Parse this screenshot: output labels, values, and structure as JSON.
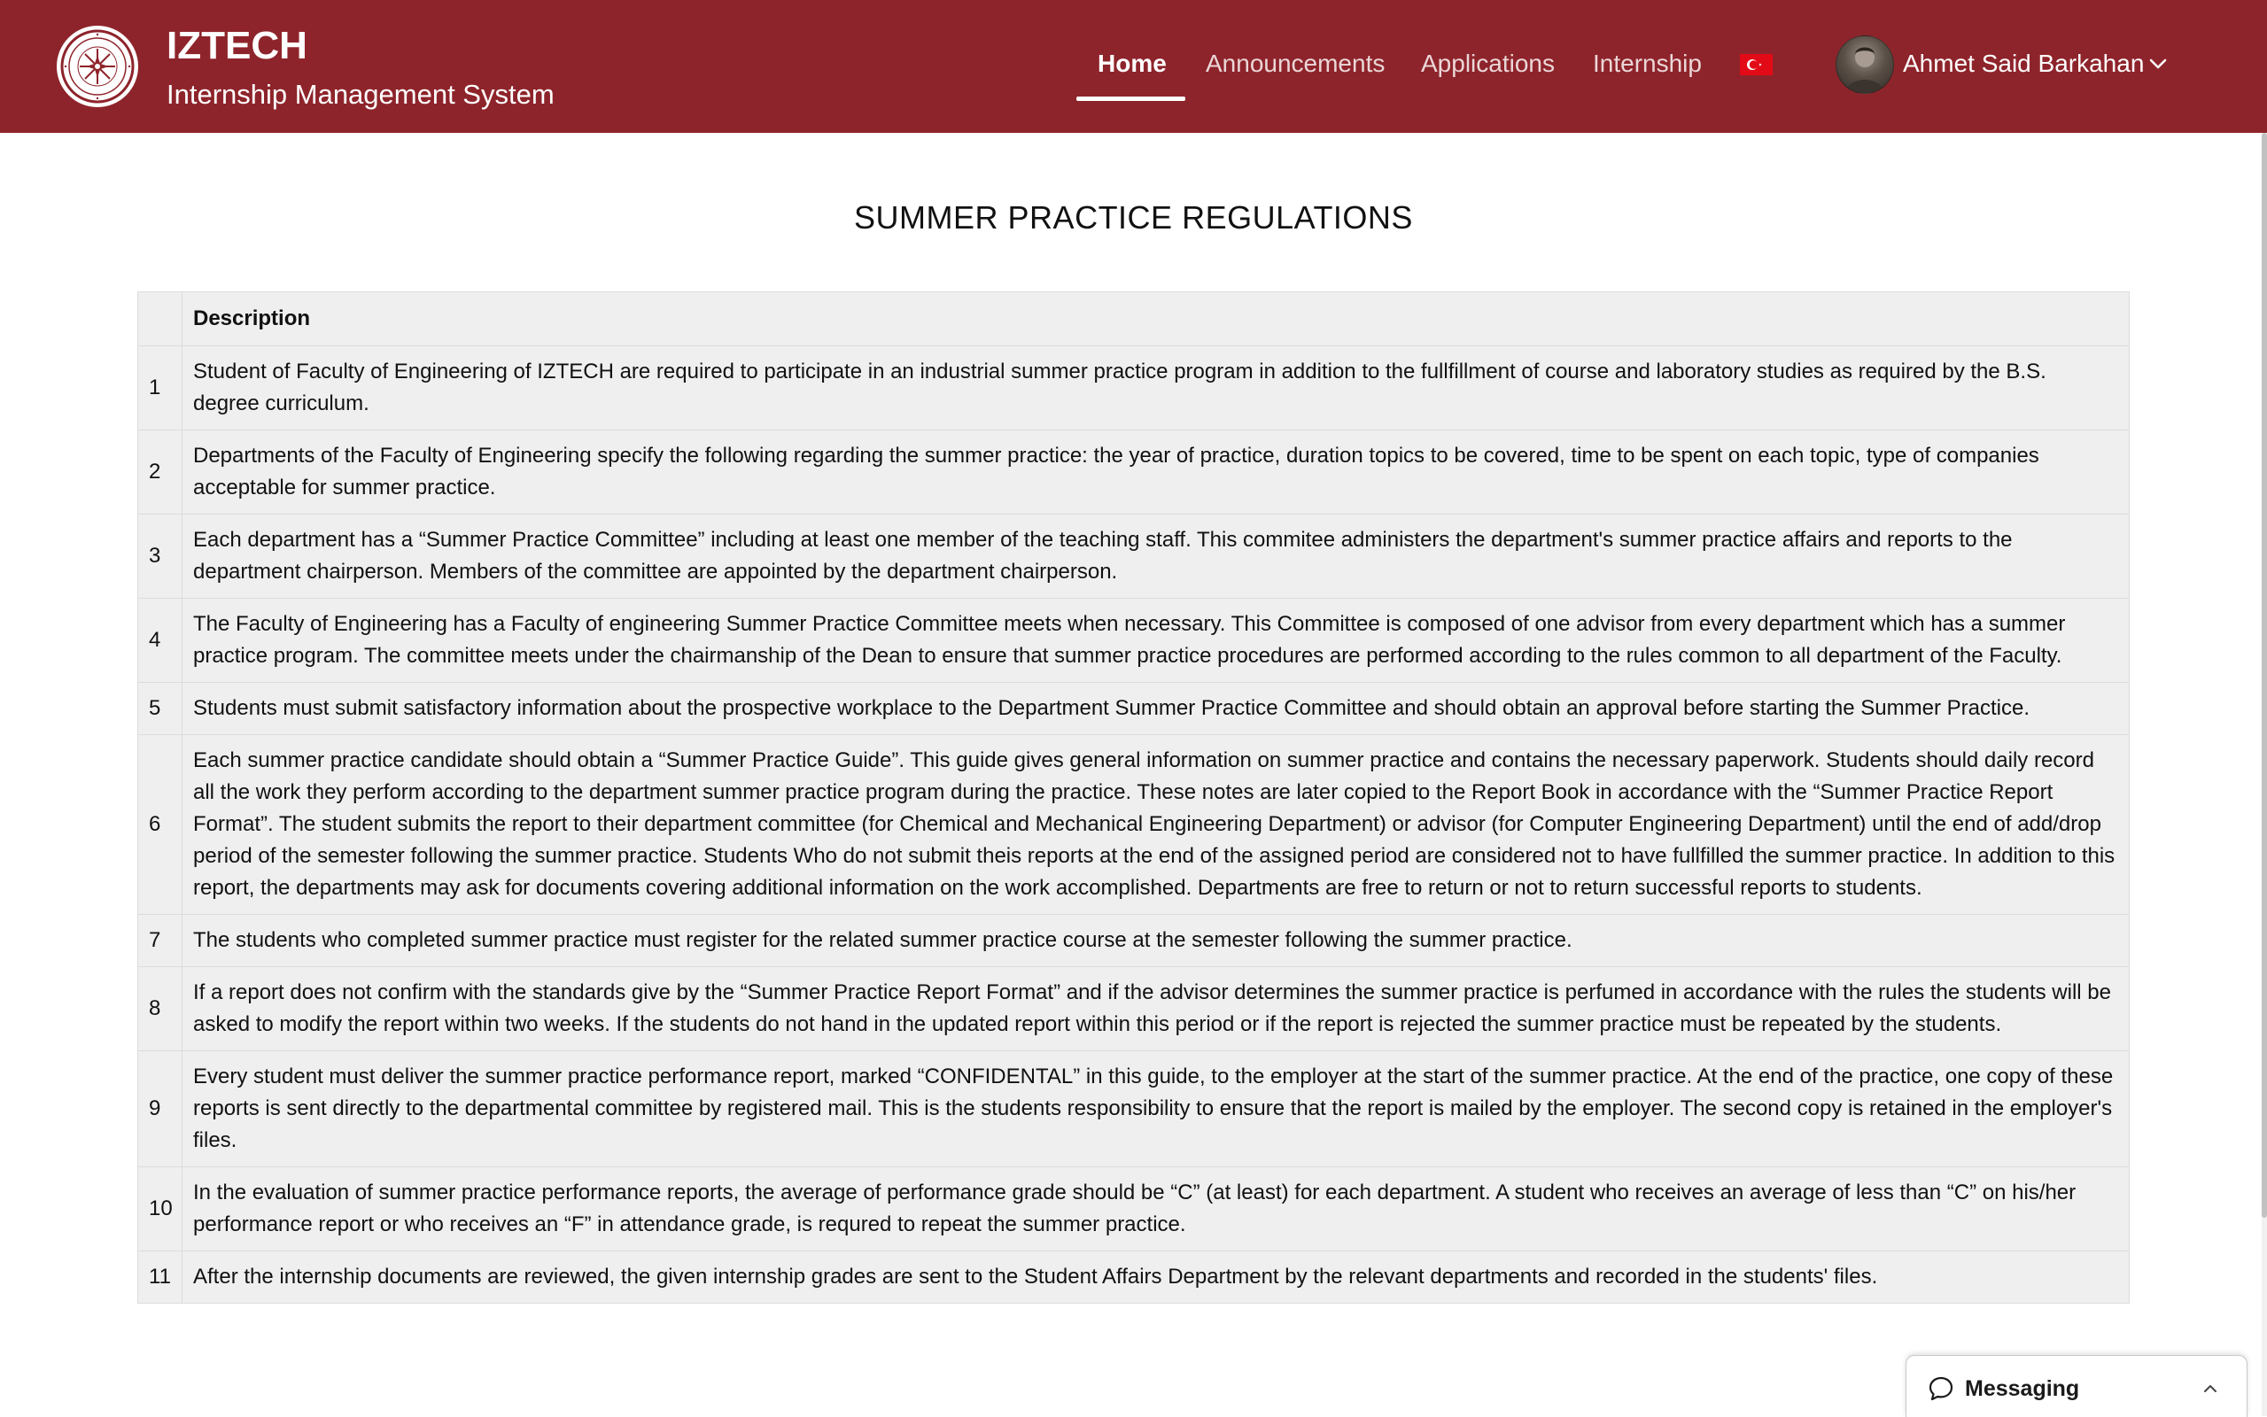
{
  "header": {
    "brand_title": "IZTECH",
    "brand_subtitle": "Internship Management System",
    "logo_icon": "iztech-seal-icon",
    "background_color": "#8e242b",
    "nav": [
      {
        "label": "Home",
        "active": true
      },
      {
        "label": "Announcements",
        "active": false
      },
      {
        "label": "Applications",
        "active": false
      },
      {
        "label": "Internship",
        "active": false
      }
    ],
    "language_flag": "turkish-flag-icon",
    "user_name": "Ahmet Said Barkahan"
  },
  "main": {
    "title": "SUMMER PRACTICE REGULATIONS",
    "table": {
      "column_headers": [
        "",
        "Description"
      ],
      "rows": [
        {
          "num": "1",
          "text": "Student of Faculty of Engineering of IZTECH are required to participate in an industrial summer practice program in addition to the fullfillment of course and laboratory studies as required by the B.S. degree curriculum."
        },
        {
          "num": "2",
          "text": "Departments of the Faculty of Engineering specify the following regarding the summer practice: the year of practice, duration topics to be covered, time to be spent on each topic, type of companies acceptable for summer practice."
        },
        {
          "num": "3",
          "text": "Each department has a “Summer Practice Committee” including at least one member of the teaching staff. This commitee administers the department's summer practice affairs and reports to the department chairperson. Members of the committee are appointed by the department chairperson."
        },
        {
          "num": "4",
          "text": "The Faculty of Engineering has a Faculty of engineering Summer Practice Committee meets when necessary. This Committee is composed of one advisor from every department which has a summer practice program. The committee meets under the chairmanship of the Dean to ensure that summer practice procedures are performed according to the rules common to all department of the Faculty."
        },
        {
          "num": "5",
          "text": "Students must submit satisfactory information about the prospective workplace to the Department Summer Practice Committee and should obtain an approval before starting the Summer Practice."
        },
        {
          "num": "6",
          "text": "Each summer practice candidate should obtain a “Summer Practice Guide”. This guide gives general information on summer practice and contains the necessary paperwork. Students should daily record all the work they perform according to the department summer practice program during the practice. These notes are later copied to the Report Book in accordance with the “Summer Practice Report Format”. The student submits the report to their department committee (for Chemical and Mechanical Engineering Department) or advisor (for Computer Engineering Department) until the end of add/drop period of the semester following the summer practice. Students Who do not submit theis reports at the end of the assigned period are considered not to have fullfilled the summer practice. In addition to this report, the departments may ask for documents covering additional information on the work accomplished. Departments are free to return or not to return successful reports to students."
        },
        {
          "num": "7",
          "text": "The students who completed summer practice must register for the related summer practice course at the semester following the summer practice."
        },
        {
          "num": "8",
          "text": "If a report does not confirm with the standards give by the “Summer Practice Report Format” and if the advisor determines the summer practice is perfumed in accordance with the rules the students will be asked to modify the report within two weeks. If the students do not hand in the updated report within this period or if the report is rejected the summer practice must be repeated by the students."
        },
        {
          "num": "9",
          "text": "Every student must deliver the summer practice performance report, marked “CONFIDENTAL” in this guide, to the employer at the start of the summer practice. At the end of the practice, one copy of these reports is sent directly to the departmental committee by registered mail. This is the students responsibility to ensure that the report is mailed by the employer. The second copy is retained in the employer's files."
        },
        {
          "num": "10",
          "text": "In the evaluation of summer practice performance reports, the average of performance grade should be “C” (at least) for each department. A student who receives an average of less than “C” on his/her performance report or who receives an “F” in attendance grade, is requred to repeat the summer practice."
        },
        {
          "num": "11",
          "text": "After the internship documents are reviewed, the given internship grades are sent to the Student Affairs Department by the relevant departments and recorded in the students' files."
        }
      ]
    }
  },
  "messaging": {
    "label": "Messaging",
    "icon": "chat-bubble-icon"
  }
}
